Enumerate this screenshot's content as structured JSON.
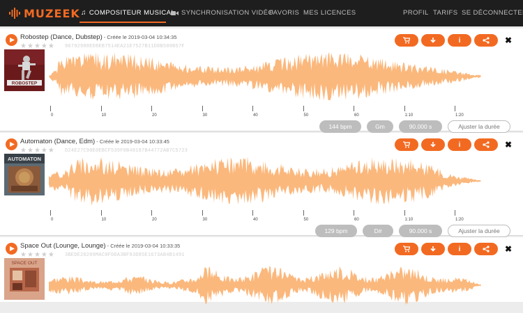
{
  "nav": {
    "logo": "MUZEEK",
    "items": [
      {
        "label": "COMPOSITEUR MUSICAL",
        "icon": "music-note-icon",
        "active": true
      },
      {
        "label": "SYNCHRONISATION VIDÉO",
        "icon": "video-camera-icon",
        "active": false
      },
      {
        "label": "FAVORIS",
        "active": false
      },
      {
        "label": "MES LICENCES",
        "active": false
      },
      {
        "label": "PROFIL",
        "active": false
      },
      {
        "label": "TARIFS",
        "active": false
      },
      {
        "label": "SE DÉCONNECTER",
        "active": false
      }
    ]
  },
  "colors": {
    "accent": "#f26a22",
    "wave": "#fbb87d",
    "chip": "#bdbdbd"
  },
  "timeline_labels": [
    "0",
    "10",
    "20",
    "30",
    "40",
    "50",
    "60",
    "1:10",
    "1:20"
  ],
  "actions": [
    "cart-icon",
    "download-icon",
    "info-icon",
    "share-icon"
  ],
  "tracks": [
    {
      "title": "Robostep (Dance, Dubstep)",
      "created": " - Créée le 2019-03-04 10:34:35",
      "hash": "96792988ED8EB7514EA21E7527B11D8B509B57F",
      "cover_text": "ROBOSTEP",
      "bpm": "144 bpm",
      "key": "Gm",
      "duration": "90.000 s",
      "adjust": "Ajuster la durée"
    },
    {
      "title": "Automaton (Dance, Edm)",
      "created": " - Créée le 2019-03-04 10:33:45",
      "hash": "D24E27C90E0EBCF539F0B48187B44772AB7C5723",
      "cover_text": "AUTOMATON",
      "bpm": "129 bpm",
      "key": "D#",
      "duration": "90.000 s",
      "adjust": "Ajuster la durée"
    },
    {
      "title": "Space Out (Lounge, Lounge)",
      "created": " - Créée le 2019-03-04 10:33:35",
      "hash": "3BEDE20209MAC0F0DA3BF93D85E1673AB4B1491",
      "cover_text": "SPACE OUT"
    }
  ]
}
